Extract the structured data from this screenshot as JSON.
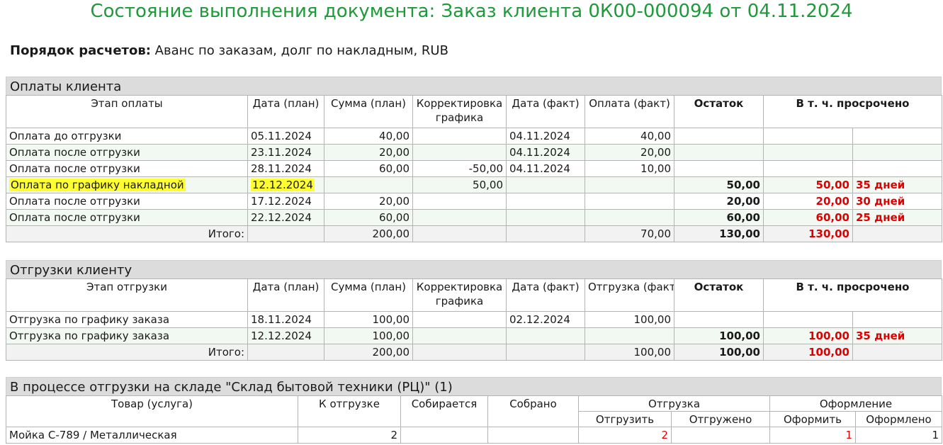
{
  "title": "Состояние выполнения документа: Заказ клиента 0К00-000094 от 04.11.2024",
  "order": {
    "label": "Порядок расчетов:",
    "value": "Аванс по заказам, долг по накладным, RUB"
  },
  "payments": {
    "header": "Оплаты клиента",
    "cols": [
      "Этап оплаты",
      "Дата (план)",
      "Сумма (план)",
      "Корректировка графика",
      "Дата (факт)",
      "Оплата (факт)",
      "Остаток",
      "В т. ч. просрочено"
    ],
    "rows": [
      {
        "stage": "Оплата до отгрузки",
        "date_plan": "05.11.2024",
        "sum_plan": "40,00",
        "corr": "",
        "date_fact": "04.11.2024",
        "paid": "40,00",
        "rest": "",
        "overdue": "",
        "days": ""
      },
      {
        "stage": "Оплата после отгрузки",
        "date_plan": "23.11.2024",
        "sum_plan": "20,00",
        "corr": "",
        "date_fact": "04.11.2024",
        "paid": "20,00",
        "rest": "",
        "overdue": "",
        "days": ""
      },
      {
        "stage": "Оплата после отгрузки",
        "date_plan": "28.11.2024",
        "sum_plan": "60,00",
        "corr": "-50,00",
        "date_fact": "04.11.2024",
        "paid": "10,00",
        "rest": "",
        "overdue": "",
        "days": ""
      },
      {
        "stage": "Оплата по графику накладной",
        "date_plan": "12.12.2024",
        "sum_plan": "",
        "corr": "50,00",
        "date_fact": "",
        "paid": "",
        "rest": "50,00",
        "overdue": "50,00",
        "days": "35 дней"
      },
      {
        "stage": "Оплата после отгрузки",
        "date_plan": "17.12.2024",
        "sum_plan": "20,00",
        "corr": "",
        "date_fact": "",
        "paid": "",
        "rest": "20,00",
        "overdue": "20,00",
        "days": "30 дней"
      },
      {
        "stage": "Оплата после отгрузки",
        "date_plan": "22.12.2024",
        "sum_plan": "60,00",
        "corr": "",
        "date_fact": "",
        "paid": "",
        "rest": "60,00",
        "overdue": "60,00",
        "days": "25 дней"
      }
    ],
    "total": {
      "label": "Итого:",
      "sum_plan": "200,00",
      "paid": "70,00",
      "rest": "130,00",
      "overdue": "130,00"
    }
  },
  "shipments": {
    "header": "Отгрузки клиенту",
    "cols": [
      "Этап отгрузки",
      "Дата (план)",
      "Сумма (план)",
      "Корректировка графика",
      "Дата (факт)",
      "Отгрузка (факт)",
      "Остаток",
      "В т. ч. просрочено"
    ],
    "rows": [
      {
        "stage": "Отгрузка по графику заказа",
        "date_plan": "18.11.2024",
        "sum_plan": "100,00",
        "corr": "",
        "date_fact": "02.12.2024",
        "shipped": "100,00",
        "rest": "",
        "overdue": "",
        "days": ""
      },
      {
        "stage": "Отгрузка по графику заказа",
        "date_plan": "12.12.2024",
        "sum_plan": "100,00",
        "corr": "",
        "date_fact": "",
        "shipped": "",
        "rest": "100,00",
        "overdue": "100,00",
        "days": "35 дней"
      }
    ],
    "total": {
      "label": "Итого:",
      "sum_plan": "200,00",
      "shipped": "100,00",
      "rest": "100,00",
      "overdue": "100,00"
    }
  },
  "warehouse": {
    "header": "В процессе отгрузки на складе \"Склад бытовой техники (РЦ)\" (1)",
    "cols": {
      "item": "Товар (услуга)",
      "to_ship": "К отгрузке",
      "collecting": "Собирается",
      "collected": "Собрано",
      "shipment": "Отгрузка",
      "registration": "Оформление",
      "ship_todo": "Отгрузить",
      "ship_done": "Отгружено",
      "reg_todo": "Оформить",
      "reg_done": "Оформлено"
    },
    "rows": [
      {
        "item": "Мойка C-789 / Металлическая",
        "to_ship": "2",
        "collecting": "",
        "collected": "",
        "ship_todo": "2",
        "ship_done": "",
        "reg_todo": "1",
        "reg_done": "1"
      }
    ]
  },
  "colors": {
    "title": "#1f9a3a",
    "overdue": "#e00000",
    "highlight": "#ffff33"
  }
}
